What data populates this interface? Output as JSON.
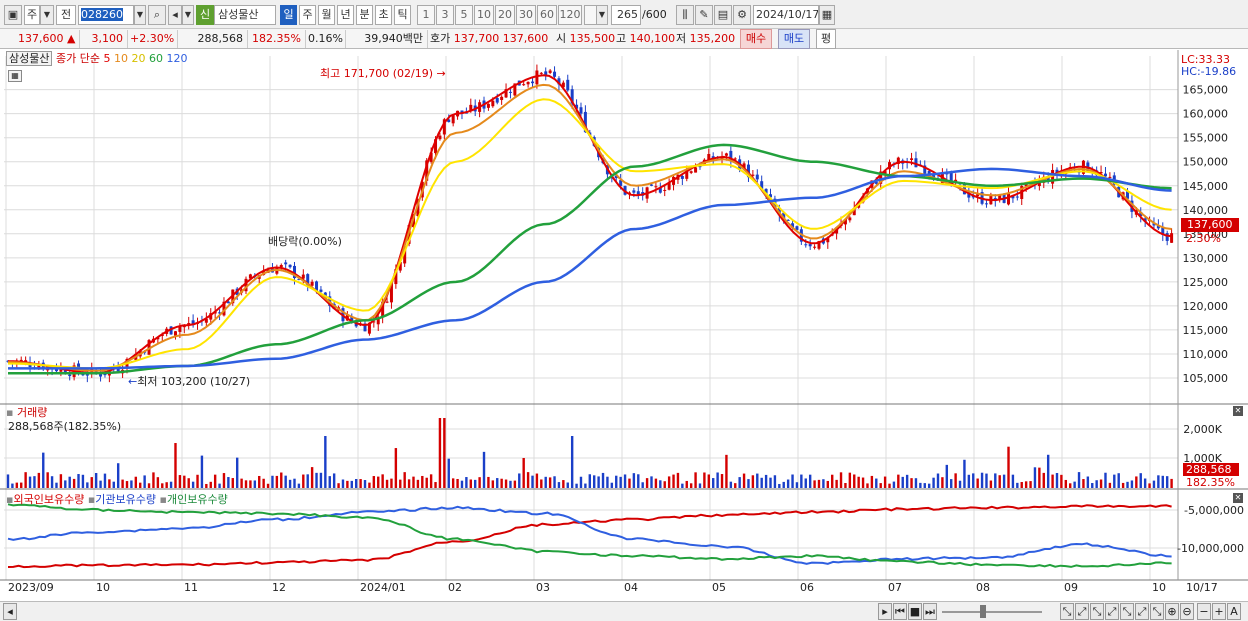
{
  "toolbar": {
    "market": "주",
    "kind": "전",
    "code": "028260",
    "badge": "신",
    "name": "삼성물산",
    "periods": [
      "일",
      "주",
      "월",
      "년",
      "분",
      "초",
      "틱"
    ],
    "selected_period": "일",
    "nums": [
      "1",
      "3",
      "5",
      "10",
      "20",
      "30",
      "60",
      "120"
    ],
    "count": "265",
    "total": "/600",
    "date": "2024/10/17"
  },
  "quote": {
    "price": "137,600",
    "change": "3,100",
    "change_pct": "+2.30%",
    "volume": "288,568",
    "vol_ratio": "182.35%",
    "turnover": "0.16%",
    "amount": "39,940백만",
    "bid_label": "호가",
    "bid": "137,700",
    "ask": "137,600",
    "open_label": "시",
    "open": "135,500",
    "high_label": "고",
    "high": "140,100",
    "low_label": "저",
    "low": "135,200",
    "buy_btn": "매수",
    "sell_btn": "매도",
    "avg_btn": "평"
  },
  "legend": {
    "stock": "삼성물산",
    "ma_label": "종가 단순",
    "ma_periods": [
      "5",
      "10",
      "20",
      "60",
      "120"
    ],
    "lc": "LC:33.33",
    "hc": "HC:-19.86"
  },
  "annotations": {
    "high": "최고 171,700 (02/19)",
    "low": "최저 103,200 (10/27)",
    "dividend": "배당락(0.00%)"
  },
  "volume_panel": {
    "title": "거래량",
    "value": "288,568주(182.35%)",
    "ticks": [
      "2,000K",
      "1,000K"
    ],
    "last": "288,568",
    "last_pct": "182.35%"
  },
  "holdings_panel": {
    "legend": [
      "외국인보유수량",
      "기관보유수량",
      "개인보유수량"
    ],
    "ticks": [
      "-5,000,000",
      "-10,000,000"
    ]
  },
  "price_axis": {
    "ticks": [
      "165,000",
      "160,000",
      "155,000",
      "150,000",
      "145,000",
      "140,000",
      "135,000",
      "130,000",
      "125,000",
      "120,000",
      "115,000",
      "110,000",
      "105,000"
    ],
    "current": "137,600",
    "current_pct": "2.30%"
  },
  "date_axis": {
    "labels": [
      "2023/09",
      "10",
      "11",
      "12",
      "2024/01",
      "02",
      "03",
      "04",
      "05",
      "06",
      "07",
      "08",
      "09",
      "10"
    ],
    "end": "10/17"
  },
  "colors": {
    "ma5": "#e00000",
    "ma10": "#e58a1c",
    "ma20": "#ffe400",
    "ma60": "#22a03c",
    "ma120": "#2f5fe0",
    "up": "#d40000",
    "down": "#1a3fc8"
  },
  "chart_data": {
    "type": "line",
    "x": [
      "2023/09",
      "2023/10",
      "2023/11",
      "2023/12",
      "2024/01",
      "2024/02",
      "2024/03",
      "2024/04",
      "2024/05",
      "2024/06",
      "2024/07",
      "2024/08",
      "2024/09",
      "2024/10"
    ],
    "series": [
      {
        "name": "5",
        "values": [
          108500,
          106000,
          116000,
          128000,
          116000,
          160000,
          168000,
          143000,
          151000,
          133000,
          150000,
          142000,
          149000,
          134500
        ]
      },
      {
        "name": "10",
        "values": [
          108300,
          106500,
          114000,
          127500,
          117000,
          156000,
          166000,
          145000,
          150500,
          134000,
          148000,
          143000,
          148500,
          136000
        ]
      },
      {
        "name": "20",
        "values": [
          108000,
          107000,
          111000,
          126000,
          119000,
          150000,
          163000,
          148000,
          149500,
          136000,
          146000,
          144500,
          148000,
          140000
        ]
      },
      {
        "name": "60",
        "values": [
          106000,
          106000,
          107500,
          112000,
          117000,
          125000,
          137000,
          149000,
          153500,
          150000,
          147000,
          145000,
          146500,
          144500
        ]
      },
      {
        "name": "120",
        "values": [
          107000,
          107000,
          107500,
          109000,
          113000,
          117000,
          125000,
          136000,
          141000,
          142500,
          147000,
          148500,
          147000,
          144000
        ]
      }
    ],
    "ylim": [
      100000,
      172000
    ]
  }
}
